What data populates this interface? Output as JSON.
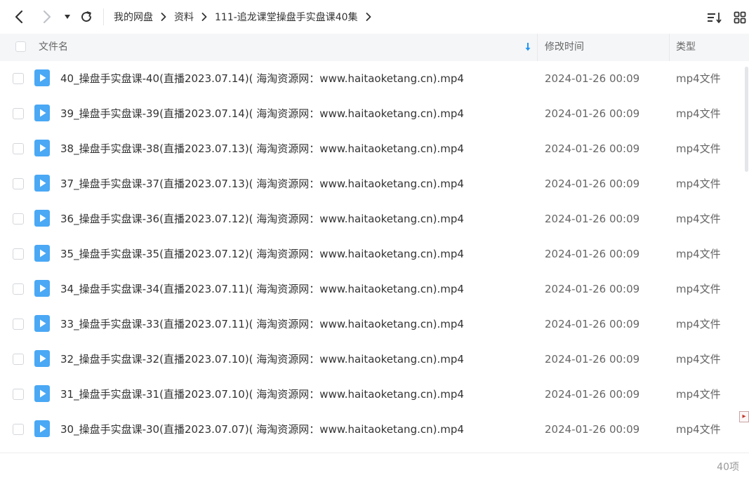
{
  "breadcrumb": [
    {
      "label": "我的网盘"
    },
    {
      "label": "资料"
    },
    {
      "label": "111-追龙课堂操盘手实盘课40集"
    }
  ],
  "columns": {
    "name": "文件名",
    "time": "修改时间",
    "type": "类型"
  },
  "files": [
    {
      "name": "40_操盘手实盘课-40(直播2023.07.14)( 海淘资源网：www.haitaoketang.cn).mp4",
      "time": "2024-01-26 00:09",
      "type": "mp4文件"
    },
    {
      "name": "39_操盘手实盘课-39(直播2023.07.14)( 海淘资源网：www.haitaoketang.cn).mp4",
      "time": "2024-01-26 00:09",
      "type": "mp4文件"
    },
    {
      "name": "38_操盘手实盘课-38(直播2023.07.13)( 海淘资源网：www.haitaoketang.cn).mp4",
      "time": "2024-01-26 00:09",
      "type": "mp4文件"
    },
    {
      "name": "37_操盘手实盘课-37(直播2023.07.13)( 海淘资源网：www.haitaoketang.cn).mp4",
      "time": "2024-01-26 00:09",
      "type": "mp4文件"
    },
    {
      "name": "36_操盘手实盘课-36(直播2023.07.12)( 海淘资源网：www.haitaoketang.cn).mp4",
      "time": "2024-01-26 00:09",
      "type": "mp4文件"
    },
    {
      "name": "35_操盘手实盘课-35(直播2023.07.12)( 海淘资源网：www.haitaoketang.cn).mp4",
      "time": "2024-01-26 00:09",
      "type": "mp4文件"
    },
    {
      "name": "34_操盘手实盘课-34(直播2023.07.11)( 海淘资源网：www.haitaoketang.cn).mp4",
      "time": "2024-01-26 00:09",
      "type": "mp4文件"
    },
    {
      "name": "33_操盘手实盘课-33(直播2023.07.11)( 海淘资源网：www.haitaoketang.cn).mp4",
      "time": "2024-01-26 00:09",
      "type": "mp4文件"
    },
    {
      "name": "32_操盘手实盘课-32(直播2023.07.10)( 海淘资源网：www.haitaoketang.cn).mp4",
      "time": "2024-01-26 00:09",
      "type": "mp4文件"
    },
    {
      "name": "31_操盘手实盘课-31(直播2023.07.10)( 海淘资源网：www.haitaoketang.cn).mp4",
      "time": "2024-01-26 00:09",
      "type": "mp4文件"
    },
    {
      "name": "30_操盘手实盘课-30(直播2023.07.07)( 海淘资源网：www.haitaoketang.cn).mp4",
      "time": "2024-01-26 00:09",
      "type": "mp4文件"
    }
  ],
  "footer": {
    "item_count": "40项"
  },
  "icons": {
    "back": "chevron-left-icon",
    "forward": "chevron-right-icon",
    "history": "caret-down-icon",
    "refresh": "refresh-icon",
    "breadcrumb_separator": "chevron-right-icon",
    "sort": "sort-list-icon",
    "view": "grid-view-icon",
    "column_sort": "arrow-down-icon",
    "file": "video-file-icon"
  },
  "colors": {
    "accent": "#2196f3",
    "file_icon": "#4aa8f5",
    "header_bg": "#f5f6f8",
    "text": "#333333",
    "muted": "#666666",
    "count": "#999999"
  }
}
